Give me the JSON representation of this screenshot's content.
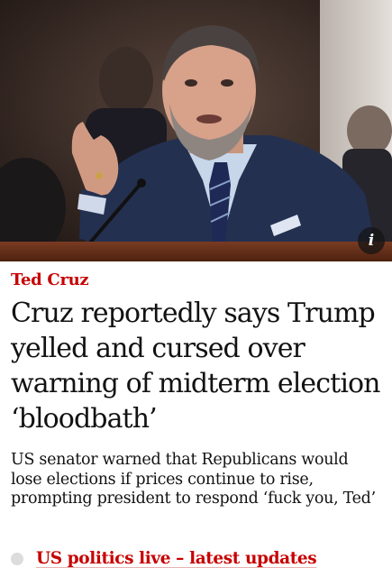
{
  "hero": {
    "image_subject": "man in suit speaking at hearing, gesturing with hand",
    "info_icon_glyph": "i"
  },
  "article": {
    "kicker": "Ted Cruz",
    "headline": "Cruz reportedly says Trump yelled and cursed over warning of midterm election ‘bloodbath’",
    "standfirst": "US senator warned that Republicans would lose elections if prices continue to rise, prompting president to respond ‘fuck you, Ted’",
    "live_link": "US politics live – latest updates"
  },
  "colors": {
    "kicker": "#c70000",
    "text": "#121212",
    "live_dot": "#dcdcdc"
  }
}
